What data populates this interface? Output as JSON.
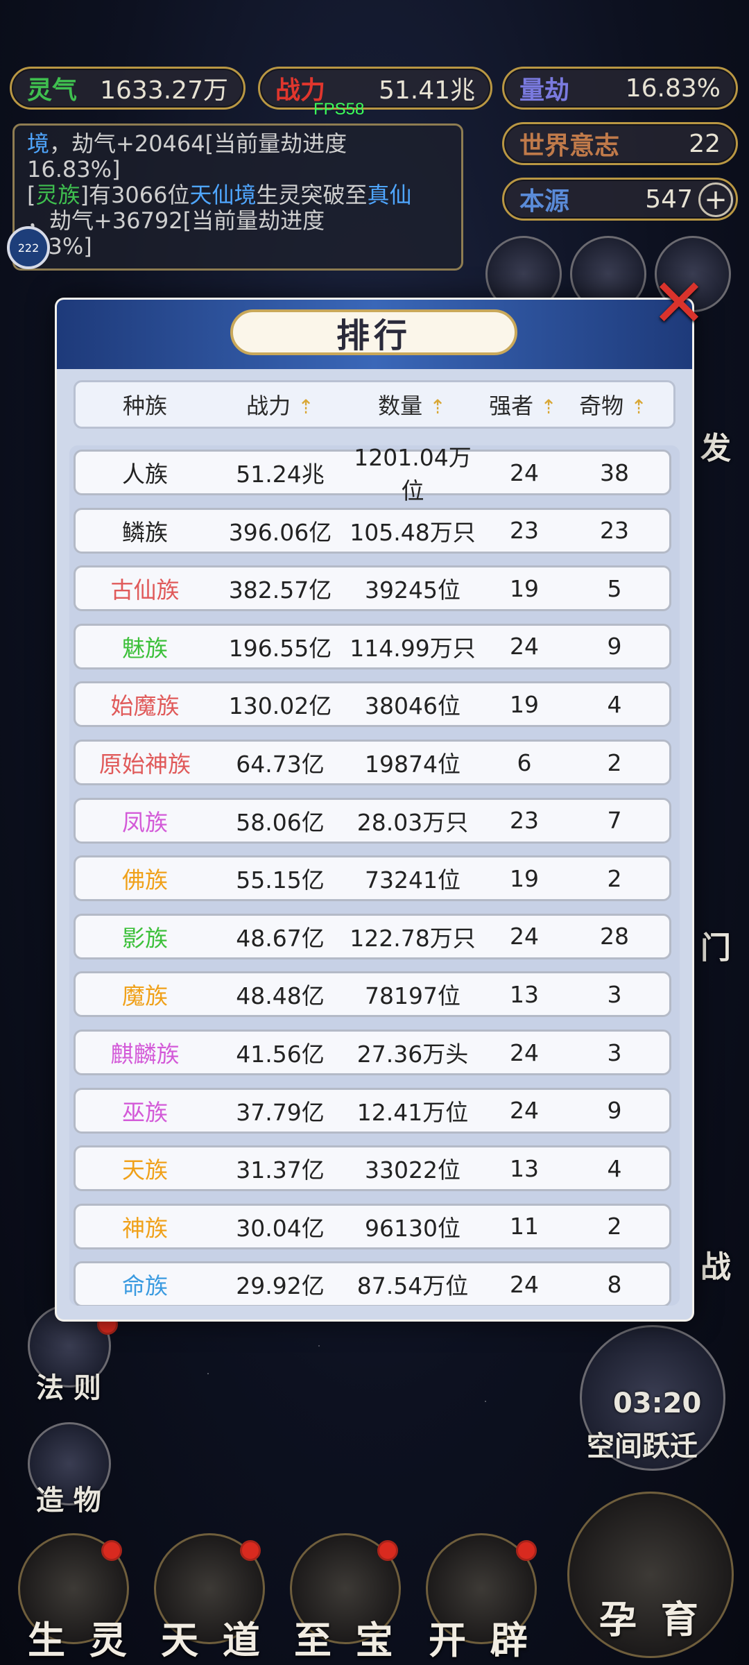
{
  "stats": {
    "lingqi": {
      "label": "灵气",
      "value": "1633.27万",
      "color": "#3fbf4f"
    },
    "zhanli": {
      "label": "战力",
      "value": "51.41兆",
      "color": "#e0362d"
    },
    "liangjie": {
      "label": "量劫",
      "value": "16.83%",
      "color": "#7a7adf"
    },
    "shijie": {
      "label": "世界意志",
      "value": "22",
      "color": "#c07a4a"
    },
    "benyuan": {
      "label": "本源",
      "value": "547",
      "color": "#5a8bd8"
    }
  },
  "fps": "FPS58",
  "log": {
    "line1_a": "境",
    "line1_b": "，劫气+20464[当前量劫进度",
    "line2": "16.83%]",
    "line3_open": "[",
    "line3_race": "灵族",
    "line3_mid": "]有3066位",
    "line3_realm": "天仙境",
    "line3_after": "生灵突破至",
    "line3_target": "真仙",
    "line4": "，劫气+36792[当前量劫进度",
    "line5": ".83%]"
  },
  "avatar_badge": "222",
  "side": {
    "right_fa": "发",
    "right_men": "门",
    "right_zhan": "战",
    "fa_ze": "法 则",
    "zao_wu": "造 物",
    "kongjian_time": "03:20",
    "kongjian_label": "空间跃迁"
  },
  "modal": {
    "title": "排行",
    "close_icon": "✕",
    "headers": [
      "种族",
      "战力",
      "数量",
      "强者",
      "奇物"
    ],
    "sort_icon": "⇡",
    "rows": [
      {
        "race": "人族",
        "power": "51.24兆",
        "count": "1201.04万位",
        "strong": "24",
        "treasure": "38",
        "color": "#222222"
      },
      {
        "race": "鳞族",
        "power": "396.06亿",
        "count": "105.48万只",
        "strong": "23",
        "treasure": "23",
        "color": "#222222"
      },
      {
        "race": "古仙族",
        "power": "382.57亿",
        "count": "39245位",
        "strong": "19",
        "treasure": "5",
        "color": "#e05a5a"
      },
      {
        "race": "魅族",
        "power": "196.55亿",
        "count": "114.99万只",
        "strong": "24",
        "treasure": "9",
        "color": "#3cc03a"
      },
      {
        "race": "始魔族",
        "power": "130.02亿",
        "count": "38046位",
        "strong": "19",
        "treasure": "4",
        "color": "#e05a5a"
      },
      {
        "race": "原始神族",
        "power": "64.73亿",
        "count": "19874位",
        "strong": "6",
        "treasure": "2",
        "color": "#e05a5a"
      },
      {
        "race": "凤族",
        "power": "58.06亿",
        "count": "28.03万只",
        "strong": "23",
        "treasure": "7",
        "color": "#d35ad8"
      },
      {
        "race": "佛族",
        "power": "55.15亿",
        "count": "73241位",
        "strong": "19",
        "treasure": "2",
        "color": "#f0a11a"
      },
      {
        "race": "影族",
        "power": "48.67亿",
        "count": "122.78万只",
        "strong": "24",
        "treasure": "28",
        "color": "#3cc03a"
      },
      {
        "race": "魔族",
        "power": "48.48亿",
        "count": "78197位",
        "strong": "13",
        "treasure": "3",
        "color": "#f0a11a"
      },
      {
        "race": "麒麟族",
        "power": "41.56亿",
        "count": "27.36万头",
        "strong": "24",
        "treasure": "3",
        "color": "#d35ad8"
      },
      {
        "race": "巫族",
        "power": "37.79亿",
        "count": "12.41万位",
        "strong": "24",
        "treasure": "9",
        "color": "#d35ad8"
      },
      {
        "race": "天族",
        "power": "31.37亿",
        "count": "33022位",
        "strong": "13",
        "treasure": "4",
        "color": "#f0a11a"
      },
      {
        "race": "神族",
        "power": "30.04亿",
        "count": "96130位",
        "strong": "11",
        "treasure": "2",
        "color": "#f0a11a"
      },
      {
        "race": "命族",
        "power": "29.92亿",
        "count": "87.54万位",
        "strong": "24",
        "treasure": "8",
        "color": "#3b9be0"
      }
    ]
  },
  "bottom_nav": [
    "生 灵",
    "天 道",
    "至 宝",
    "开 辟",
    "孕 育"
  ]
}
